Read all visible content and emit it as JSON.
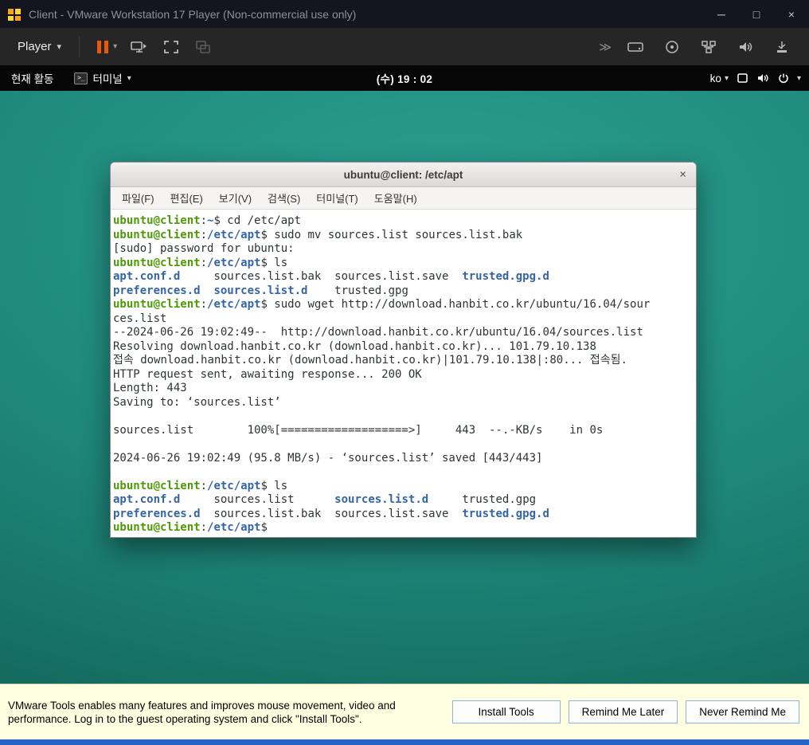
{
  "window": {
    "title": "Client - VMware Workstation 17 Player (Non-commercial use only)"
  },
  "icons": {
    "minimize": "─",
    "maximize": "□",
    "close": "×",
    "caret_down": "▾",
    "chevron_double": "≫",
    "terminal_glyph": ">_"
  },
  "toolbar": {
    "player_label": "Player"
  },
  "gnome_bar": {
    "activities": "현재 활동",
    "app_label": "터미널",
    "clock": "(수) 19 : 02",
    "keyboard_layout": "ko"
  },
  "terminal": {
    "title": "ubuntu@client: /etc/apt",
    "menu": [
      "파일(F)",
      "편집(E)",
      "보기(V)",
      "검색(S)",
      "터미널(T)",
      "도움말(H)"
    ],
    "lines": [
      [
        {
          "t": "ubuntu@client",
          "c": "u"
        },
        {
          "t": ":",
          "c": ""
        },
        {
          "t": "~",
          "c": "p"
        },
        {
          "t": "$ cd /etc/apt",
          "c": ""
        }
      ],
      [
        {
          "t": "ubuntu@client",
          "c": "u"
        },
        {
          "t": ":",
          "c": ""
        },
        {
          "t": "/etc/apt",
          "c": "p"
        },
        {
          "t": "$ sudo mv sources.list sources.list.bak",
          "c": ""
        }
      ],
      [
        {
          "t": "[sudo] password for ubuntu:",
          "c": ""
        }
      ],
      [
        {
          "t": "ubuntu@client",
          "c": "u"
        },
        {
          "t": ":",
          "c": ""
        },
        {
          "t": "/etc/apt",
          "c": "p"
        },
        {
          "t": "$ ls",
          "c": ""
        }
      ],
      [
        {
          "t": "apt.conf.d",
          "c": "d"
        },
        {
          "t": "     sources.list.bak  sources.list.save  ",
          "c": ""
        },
        {
          "t": "trusted.gpg.d",
          "c": "d"
        }
      ],
      [
        {
          "t": "preferences.d",
          "c": "d"
        },
        {
          "t": "  ",
          "c": ""
        },
        {
          "t": "sources.list.d",
          "c": "d"
        },
        {
          "t": "    trusted.gpg",
          "c": ""
        }
      ],
      [
        {
          "t": "ubuntu@client",
          "c": "u"
        },
        {
          "t": ":",
          "c": ""
        },
        {
          "t": "/etc/apt",
          "c": "p"
        },
        {
          "t": "$ sudo wget http://download.hanbit.co.kr/ubuntu/16.04/sour",
          "c": ""
        }
      ],
      [
        {
          "t": "ces.list",
          "c": ""
        }
      ],
      [
        {
          "t": "--2024-06-26 19:02:49--  http://download.hanbit.co.kr/ubuntu/16.04/sources.list",
          "c": ""
        }
      ],
      [
        {
          "t": "Resolving download.hanbit.co.kr (download.hanbit.co.kr)... 101.79.10.138",
          "c": ""
        }
      ],
      [
        {
          "t": "접속 download.hanbit.co.kr (download.hanbit.co.kr)|101.79.10.138|:80... 접속됨.",
          "c": ""
        }
      ],
      [
        {
          "t": "HTTP request sent, awaiting response... 200 OK",
          "c": ""
        }
      ],
      [
        {
          "t": "Length: 443",
          "c": ""
        }
      ],
      [
        {
          "t": "Saving to: ‘sources.list’",
          "c": ""
        }
      ],
      [],
      [
        {
          "t": "sources.list        100%[===================>]     443  --.-KB/s    in 0s",
          "c": ""
        }
      ],
      [],
      [
        {
          "t": "2024-06-26 19:02:49 (95.8 MB/s) - ‘sources.list’ saved [443/443]",
          "c": ""
        }
      ],
      [],
      [
        {
          "t": "ubuntu@client",
          "c": "u"
        },
        {
          "t": ":",
          "c": ""
        },
        {
          "t": "/etc/apt",
          "c": "p"
        },
        {
          "t": "$ ls",
          "c": ""
        }
      ],
      [
        {
          "t": "apt.conf.d",
          "c": "d"
        },
        {
          "t": "     sources.list      ",
          "c": ""
        },
        {
          "t": "sources.list.d",
          "c": "d"
        },
        {
          "t": "     trusted.gpg",
          "c": ""
        }
      ],
      [
        {
          "t": "preferences.d",
          "c": "d"
        },
        {
          "t": "  sources.list.bak  sources.list.save  ",
          "c": ""
        },
        {
          "t": "trusted.gpg.d",
          "c": "d"
        }
      ],
      [
        {
          "t": "ubuntu@client",
          "c": "u"
        },
        {
          "t": ":",
          "c": ""
        },
        {
          "t": "/etc/apt",
          "c": "p"
        },
        {
          "t": "$",
          "c": ""
        }
      ]
    ]
  },
  "notification": {
    "message": "VMware Tools enables many features and improves mouse movement, video and performance. Log in to the guest operating system and click \"Install Tools\".",
    "buttons": [
      "Install Tools",
      "Remind Me Later",
      "Never Remind Me"
    ]
  },
  "colors": {
    "prompt_user": "#4e9a06",
    "prompt_path": "#3465a4",
    "directory_entry": "#3465a4",
    "desktop_teal": "#1e867a",
    "suspend_orange": "#e8590c",
    "notification_bg": "#ffffe1"
  }
}
